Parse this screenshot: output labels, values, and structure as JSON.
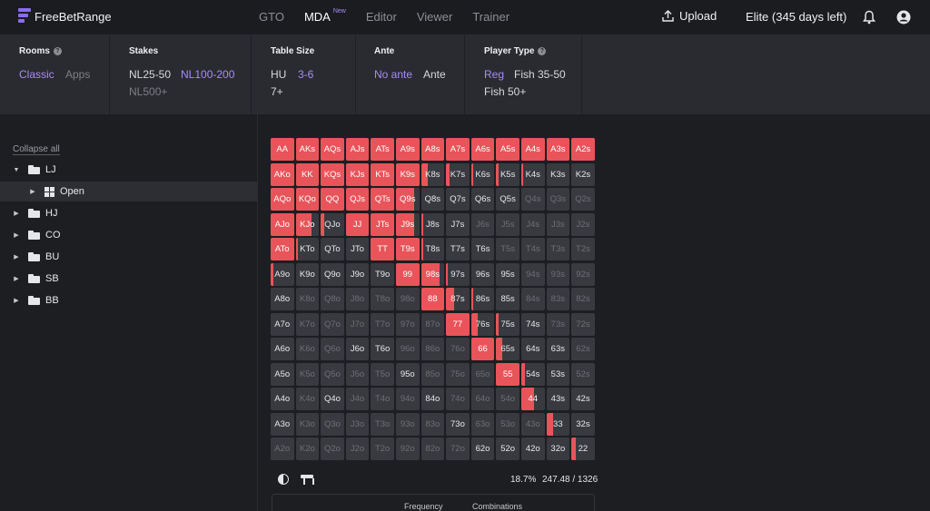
{
  "app": {
    "name": "FreeBetRange"
  },
  "nav": {
    "items": [
      {
        "label": "GTO",
        "active": false
      },
      {
        "label": "MDA",
        "active": true,
        "badge": "New"
      },
      {
        "label": "Editor",
        "active": false
      },
      {
        "label": "Viewer",
        "active": false
      },
      {
        "label": "Trainer",
        "active": false
      }
    ],
    "upload_label": "Upload",
    "plan_label": "Elite (345 days left)"
  },
  "filters": {
    "rooms": {
      "label": "Rooms",
      "options": [
        "Classic",
        "Apps"
      ],
      "selected": "Classic"
    },
    "stakes": {
      "label": "Stakes",
      "options": [
        "NL25-50",
        "NL100-200",
        "NL500+"
      ],
      "selected": "NL100-200"
    },
    "table_size": {
      "label": "Table Size",
      "options": [
        "HU",
        "3-6",
        "7+"
      ],
      "selected": "3-6"
    },
    "ante": {
      "label": "Ante",
      "options": [
        "No ante",
        "Ante"
      ],
      "selected": "No ante"
    },
    "player_type": {
      "label": "Player Type",
      "options": [
        "Reg",
        "Fish 35-50",
        "Fish 50+"
      ],
      "selected": "Reg"
    }
  },
  "sidebar": {
    "collapse_label": "Collapse all",
    "tree": [
      {
        "label": "LJ",
        "expanded": true,
        "type": "folder"
      },
      {
        "label": "Open",
        "type": "range",
        "selected": true,
        "indent": 1
      },
      {
        "label": "HJ",
        "type": "folder"
      },
      {
        "label": "CO",
        "type": "folder"
      },
      {
        "label": "BU",
        "type": "folder"
      },
      {
        "label": "SB",
        "type": "folder"
      },
      {
        "label": "BB",
        "type": "folder"
      }
    ]
  },
  "matrix": {
    "ranks": [
      "A",
      "K",
      "Q",
      "J",
      "T",
      "9",
      "8",
      "7",
      "6",
      "5",
      "4",
      "3",
      "2"
    ],
    "frequencies": [
      [
        1,
        1,
        1,
        1,
        1,
        1,
        1,
        1,
        1,
        1,
        1,
        1,
        1
      ],
      [
        1,
        1,
        1,
        1,
        1,
        1,
        0.3,
        0.15,
        0.1,
        0.1,
        0.05,
        0,
        0
      ],
      [
        1,
        1,
        1,
        1,
        1,
        0.8,
        0,
        0,
        0,
        0,
        0,
        0,
        0
      ],
      [
        1,
        0.7,
        0.15,
        1,
        1,
        0.8,
        0.1,
        0,
        0,
        0,
        0,
        0,
        0
      ],
      [
        1,
        0.1,
        0,
        0,
        1,
        1,
        0.1,
        0,
        0,
        0,
        0,
        0,
        0
      ],
      [
        0.1,
        0,
        0,
        0,
        0,
        1,
        0.8,
        0.05,
        0,
        0,
        0,
        0,
        0
      ],
      [
        0,
        0,
        0,
        0,
        0,
        0,
        1,
        0.35,
        0.1,
        0,
        0,
        0,
        0
      ],
      [
        0,
        0,
        0,
        0,
        0,
        0,
        0,
        1,
        0.3,
        0.1,
        0,
        0,
        0
      ],
      [
        0,
        0,
        0,
        0,
        0,
        0,
        0,
        0,
        1,
        0.25,
        0,
        0,
        0
      ],
      [
        0,
        0,
        0,
        0,
        0,
        0,
        0,
        0,
        0,
        1,
        0.15,
        0,
        0
      ],
      [
        0,
        0,
        0,
        0,
        0,
        0,
        0,
        0,
        0,
        0,
        0.55,
        0,
        0
      ],
      [
        0,
        0,
        0,
        0,
        0,
        0,
        0,
        0,
        0,
        0,
        0,
        0.3,
        0
      ],
      [
        0,
        0,
        0,
        0,
        0,
        0,
        0,
        0,
        0,
        0,
        0,
        0,
        0.2
      ]
    ],
    "active_hands_off": [
      "Q4o",
      "J6o",
      "T6o",
      "95o",
      "84o",
      "73o",
      "62o",
      "52o",
      "42o",
      "32o",
      "54s",
      "43s",
      "53s",
      "65s",
      "64s",
      "63s",
      "74s",
      "75s",
      "85s",
      "86s",
      "96s",
      "95s",
      "97s",
      "T7s",
      "T8s",
      "J7s",
      "J8s",
      "Q5s",
      "Q6s",
      "Q7s",
      "Q8s",
      "K2s",
      "K3s",
      "K4s",
      "K5s",
      "K6s",
      "K7s",
      "K8s",
      "T9o",
      "J9o",
      "Q9o",
      "K9o",
      "A9o",
      "A8o",
      "A7o",
      "A6o",
      "A5o",
      "A4o",
      "A3o",
      "KTo",
      "QTo",
      "JTo",
      "T6s",
      "42s",
      "32s",
      "22",
      "33",
      "44"
    ]
  },
  "summary": {
    "percent": "18.7%",
    "combos": "247.48 / 1326",
    "col_frequency": "Frequency",
    "col_combinations": "Combinations"
  },
  "colors": {
    "raise": "#e8545a",
    "cell_bg": "#383a40",
    "accent": "#a98cf5"
  }
}
